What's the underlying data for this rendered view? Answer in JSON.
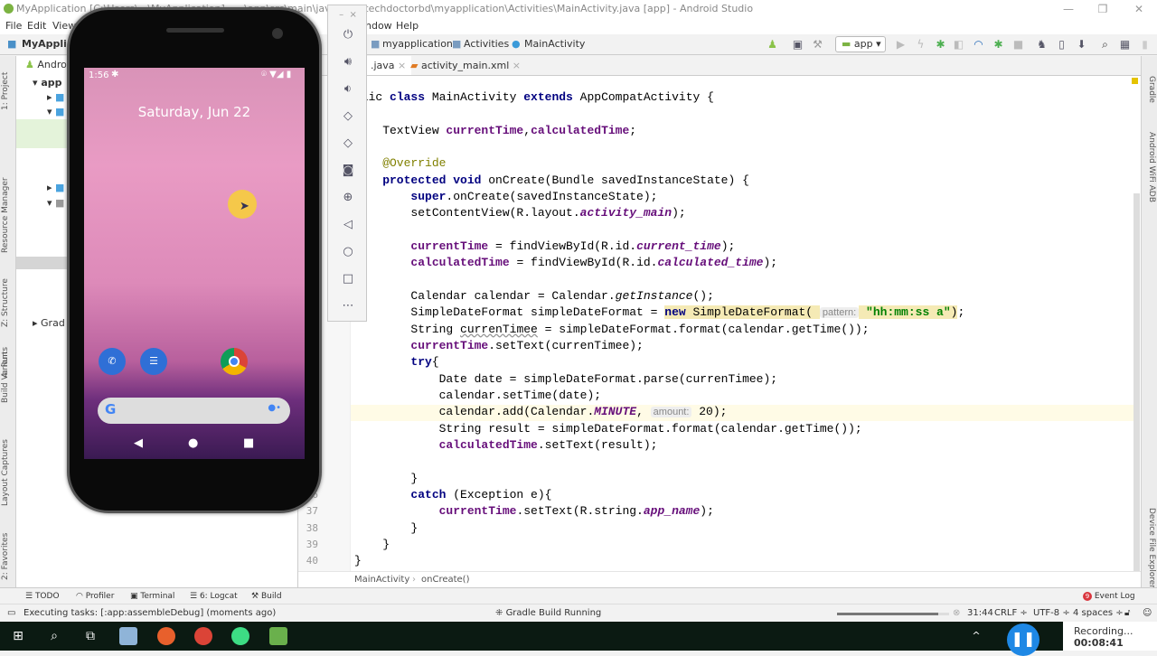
{
  "window": {
    "title": "MyApplication [C:\\Users\\...\\MyApplication] - ...\\app\\src\\main\\java\\com\\techdoctorbd\\myapplication\\Activities\\MainActivity.java [app] - Android Studio",
    "minimize": "—",
    "maximize": "❐",
    "close": "✕"
  },
  "menu": [
    "File",
    "Edit",
    "View",
    "...",
    "ndow",
    "Help"
  ],
  "nav": {
    "project": "MyApplica",
    "crumbs": [
      "myapplication",
      "Activities",
      "MainActivity"
    ],
    "run_config": "app"
  },
  "tabs": [
    {
      "label": ".java",
      "active": true
    },
    {
      "label": "activity_main.xml",
      "active": false
    }
  ],
  "project_panel": {
    "view": "Androi",
    "tree": [
      {
        "label": "app",
        "bold": true
      },
      {
        "label": "m"
      },
      {
        "label": "ja"
      },
      {
        "label": "g"
      },
      {
        "label": "r"
      },
      {
        "label": "Grad"
      }
    ]
  },
  "left_tools": [
    "1: Project",
    "Resource Manager",
    "Z: Structure",
    "4: Run",
    "Build Variants",
    "Layout Captures",
    "2: Favorites"
  ],
  "right_tools": [
    "Gradle",
    "Android WiFi ADB",
    "Device File Explorer"
  ],
  "code": {
    "line_numbers": [
      "36",
      "37",
      "38",
      "39",
      "40"
    ],
    "lines": [
      [
        [
          "",
          "blic "
        ],
        [
          "kw",
          "class "
        ],
        [
          "",
          "MainActivity "
        ],
        [
          "kw",
          "extends "
        ],
        [
          "",
          "AppCompatActivity {"
        ]
      ],
      [],
      [
        [
          "",
          "    TextView "
        ],
        [
          "fld",
          "currentTime"
        ],
        [
          "",
          ","
        ],
        [
          "fld",
          "calculatedTime"
        ],
        [
          "",
          ";"
        ]
      ],
      [],
      [
        [
          "ann",
          "    @Override"
        ]
      ],
      [
        [
          "kw",
          "    protected void "
        ],
        [
          "",
          "onCreate(Bundle savedInstanceState) {"
        ]
      ],
      [
        [
          "kw",
          "        super"
        ],
        [
          "",
          ".onCreate(savedInstanceState);"
        ]
      ],
      [
        [
          "",
          "        setContentView(R.layout."
        ],
        [
          "itaf",
          "activity_main"
        ],
        [
          "",
          ");"
        ]
      ],
      [],
      [
        [
          "fld",
          "        currentTime"
        ],
        [
          "",
          " = findViewById(R.id."
        ],
        [
          "itaf",
          "current_time"
        ],
        [
          "",
          ");"
        ]
      ],
      [
        [
          "fld",
          "        calculatedTime"
        ],
        [
          "",
          " = findViewById(R.id."
        ],
        [
          "itaf",
          "calculated_time"
        ],
        [
          "",
          ");"
        ]
      ],
      [],
      [
        [
          "",
          "        Calendar calendar = Calendar."
        ],
        [
          "ita",
          "getInstance"
        ],
        [
          "",
          "();"
        ]
      ],
      [
        [
          "",
          "        SimpleDateFormat simpleDateFormat = "
        ],
        [
          "kw hl",
          "new "
        ],
        [
          "hl",
          "SimpleDateFormat( "
        ],
        [
          "hint",
          "pattern:"
        ],
        [
          "str hl",
          " \"hh:mm:ss a\""
        ],
        [
          "hl",
          ")"
        ],
        [
          "",
          ";"
        ]
      ],
      [
        [
          "",
          "        String "
        ],
        [
          "und",
          "currenTimee"
        ],
        [
          "",
          " = simpleDateFormat.format(calendar.getTime());"
        ]
      ],
      [
        [
          "fld",
          "        currentTime"
        ],
        [
          "",
          ".setText(currenTimee);"
        ]
      ],
      [
        [
          "kw",
          "        try"
        ],
        [
          "",
          "{"
        ]
      ],
      [
        [
          "",
          "            Date date = simpleDateFormat.parse(currenTimee);"
        ]
      ],
      [
        [
          "",
          "            calendar.setTime(date);"
        ]
      ],
      [
        [
          "",
          "            calendar.add(Calendar."
        ],
        [
          "itaf",
          "MINUTE"
        ],
        [
          "",
          ", "
        ],
        [
          "hint",
          "amount:"
        ],
        [
          "",
          " 20);"
        ]
      ],
      [
        [
          "",
          "            String result = simpleDateFormat.format(calendar.getTime());"
        ]
      ],
      [
        [
          "fld",
          "            calculatedTime"
        ],
        [
          "",
          ".setText(result);"
        ]
      ],
      [],
      [
        [
          "",
          "        }"
        ]
      ],
      [
        [
          "kw",
          "        catch "
        ],
        [
          "",
          "(Exception e){"
        ]
      ],
      [
        [
          "fld",
          "            currentTime"
        ],
        [
          "",
          ".setText(R.string."
        ],
        [
          "itaf",
          "app_name"
        ],
        [
          "",
          ");"
        ]
      ],
      [
        [
          "",
          "        }"
        ]
      ],
      [
        [
          "",
          "    }"
        ]
      ],
      [
        [
          "",
          "}"
        ]
      ]
    ]
  },
  "breadcrumb": [
    "MainActivity",
    "onCreate()"
  ],
  "toolwindows": [
    "TODO",
    "Profiler",
    "Terminal",
    "6: Logcat",
    "Build"
  ],
  "event_log": {
    "label": "Event Log",
    "count": "9"
  },
  "status": {
    "message": "Executing tasks: [:app:assembleDebug] (moments ago)",
    "center": "Gradle Build Running",
    "position": "31:44",
    "line_sep": "CRLF ÷",
    "encoding": "UTF-8 ÷",
    "indent": "4 spaces ÷",
    "progress": 0.9
  },
  "phone": {
    "time": "1:56",
    "date": "Saturday, Jun 22"
  },
  "recording": {
    "label": "Recording...",
    "time": "00:08:41"
  }
}
